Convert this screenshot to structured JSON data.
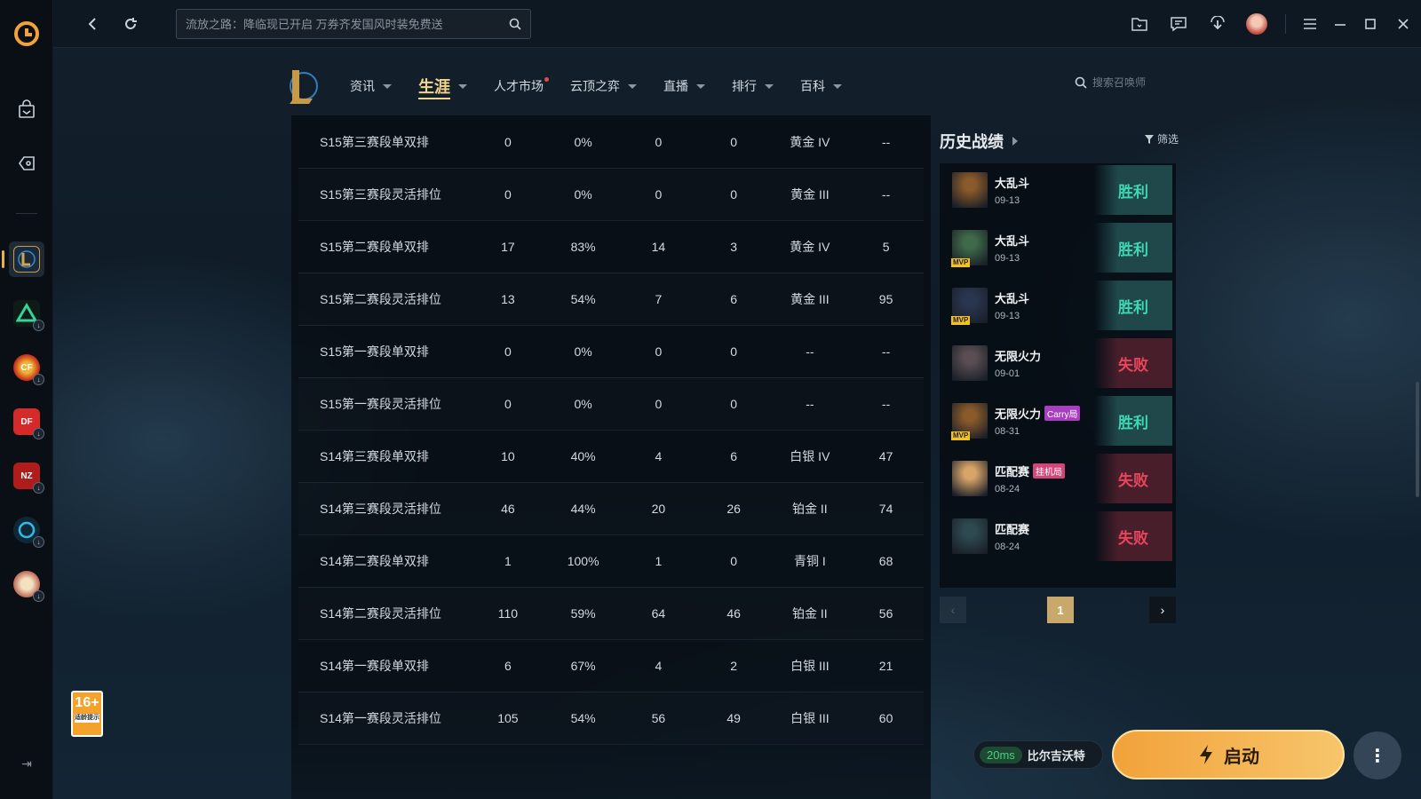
{
  "topbar": {
    "search_placeholder": "流放之路：降临现已开启 万券齐发国风时装免费送"
  },
  "subnav": {
    "tabs": [
      {
        "label": "资讯",
        "dropdown": true
      },
      {
        "label": "生涯",
        "dropdown": true,
        "active": true
      },
      {
        "label": "人才市场",
        "dropdown": false,
        "dot": true
      },
      {
        "label": "云顶之弈",
        "dropdown": true
      },
      {
        "label": "直播",
        "dropdown": true
      },
      {
        "label": "排行",
        "dropdown": true
      },
      {
        "label": "百科",
        "dropdown": true
      }
    ],
    "summoner_search_placeholder": "搜索召唤师"
  },
  "rank_table": {
    "rows": [
      {
        "season": "S15第三赛段单双排",
        "games": "0",
        "winrate": "0%",
        "wins": "0",
        "losses": "0",
        "rank": "黄金 IV",
        "points": "--"
      },
      {
        "season": "S15第三赛段灵活排位",
        "games": "0",
        "winrate": "0%",
        "wins": "0",
        "losses": "0",
        "rank": "黄金 III",
        "points": "--"
      },
      {
        "season": "S15第二赛段单双排",
        "games": "17",
        "winrate": "83%",
        "wins": "14",
        "losses": "3",
        "rank": "黄金 IV",
        "points": "5"
      },
      {
        "season": "S15第二赛段灵活排位",
        "games": "13",
        "winrate": "54%",
        "wins": "7",
        "losses": "6",
        "rank": "黄金 III",
        "points": "95"
      },
      {
        "season": "S15第一赛段单双排",
        "games": "0",
        "winrate": "0%",
        "wins": "0",
        "losses": "0",
        "rank": "--",
        "points": "--"
      },
      {
        "season": "S15第一赛段灵活排位",
        "games": "0",
        "winrate": "0%",
        "wins": "0",
        "losses": "0",
        "rank": "--",
        "points": "--"
      },
      {
        "season": "S14第三赛段单双排",
        "games": "10",
        "winrate": "40%",
        "wins": "4",
        "losses": "6",
        "rank": "白银 IV",
        "points": "47"
      },
      {
        "season": "S14第三赛段灵活排位",
        "games": "46",
        "winrate": "44%",
        "wins": "20",
        "losses": "26",
        "rank": "铂金 II",
        "points": "74"
      },
      {
        "season": "S14第二赛段单双排",
        "games": "1",
        "winrate": "100%",
        "wins": "1",
        "losses": "0",
        "rank": "青铜 I",
        "points": "68"
      },
      {
        "season": "S14第二赛段灵活排位",
        "games": "110",
        "winrate": "59%",
        "wins": "64",
        "losses": "46",
        "rank": "铂金 II",
        "points": "56"
      },
      {
        "season": "S14第一赛段单双排",
        "games": "6",
        "winrate": "67%",
        "wins": "4",
        "losses": "2",
        "rank": "白银 III",
        "points": "21"
      },
      {
        "season": "S14第一赛段灵活排位",
        "games": "105",
        "winrate": "54%",
        "wins": "56",
        "losses": "49",
        "rank": "白银 III",
        "points": "60"
      }
    ]
  },
  "history": {
    "title": "历史战绩",
    "filter_label": "筛选",
    "matches": [
      {
        "mode": "大乱斗",
        "date": "09-13",
        "result": "胜利",
        "win": true,
        "mvp": false,
        "tag": "",
        "champ_color": "#8a5a2a"
      },
      {
        "mode": "大乱斗",
        "date": "09-13",
        "result": "胜利",
        "win": true,
        "mvp": true,
        "tag": "",
        "champ_color": "#3f6a4a"
      },
      {
        "mode": "大乱斗",
        "date": "09-13",
        "result": "胜利",
        "win": true,
        "mvp": true,
        "tag": "",
        "champ_color": "#2a3550"
      },
      {
        "mode": "无限火力",
        "date": "09-01",
        "result": "失败",
        "win": false,
        "mvp": false,
        "tag": "",
        "champ_color": "#5a4e52"
      },
      {
        "mode": "无限火力",
        "date": "08-31",
        "result": "胜利",
        "win": true,
        "mvp": true,
        "tag": "Carry局",
        "tag_color": "#a83fc0",
        "champ_color": "#8a5a2a"
      },
      {
        "mode": "匹配赛",
        "date": "08-24",
        "result": "失败",
        "win": false,
        "mvp": false,
        "tag": "挂机局",
        "tag_color": "#d2467a",
        "champ_color": "#d8a468"
      },
      {
        "mode": "匹配赛",
        "date": "08-24",
        "result": "失败",
        "win": false,
        "mvp": false,
        "tag": "",
        "champ_color": "#2e4a50"
      }
    ],
    "pager": {
      "current": "1",
      "prev": "‹",
      "next": "›"
    }
  },
  "age_badge": {
    "number": "16+",
    "label": "适龄提示"
  },
  "launch": {
    "ping": "20ms",
    "server": "比尔吉沃特",
    "button_label": "启动",
    "more": "⋮"
  }
}
